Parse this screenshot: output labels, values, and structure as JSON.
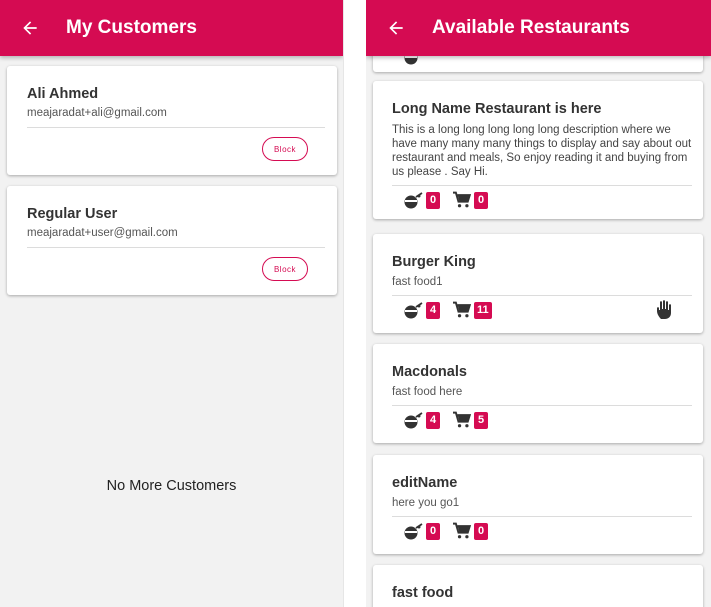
{
  "customers_screen": {
    "title": "My Customers",
    "customers": [
      {
        "name": "Ali Ahmed",
        "email": "meajaradat+ali@gmail.com",
        "action": "Block"
      },
      {
        "name": "Regular User",
        "email": "meajaradat+user@gmail.com",
        "action": "Block"
      }
    ],
    "empty_message": "No More Customers"
  },
  "restaurants_screen": {
    "title": "Available Restaurants",
    "restaurants": [
      {
        "name": "Long Name Restaurant is here",
        "description": "This is a long long long long long description where we have many many many things to display and say about out restaurant and meals, So enjoy reading it and buying from us please . Say Hi.",
        "meals": "0",
        "orders": "0"
      },
      {
        "name": "Burger King",
        "description": "fast food1",
        "meals": "4",
        "orders": "11",
        "hand_icon": "hand-icon"
      },
      {
        "name": "Macdonals",
        "description": "fast food here",
        "meals": "4",
        "orders": "5"
      },
      {
        "name": "editName",
        "description": "here you go1",
        "meals": "0",
        "orders": "0"
      },
      {
        "name": "fast food"
      }
    ]
  },
  "colors": {
    "primary": "#d50b52",
    "background": "#f2f2f2",
    "card": "#ffffff"
  },
  "icons": [
    "back-arrow-icon",
    "meals-icon",
    "cart-icon",
    "hand-icon"
  ]
}
